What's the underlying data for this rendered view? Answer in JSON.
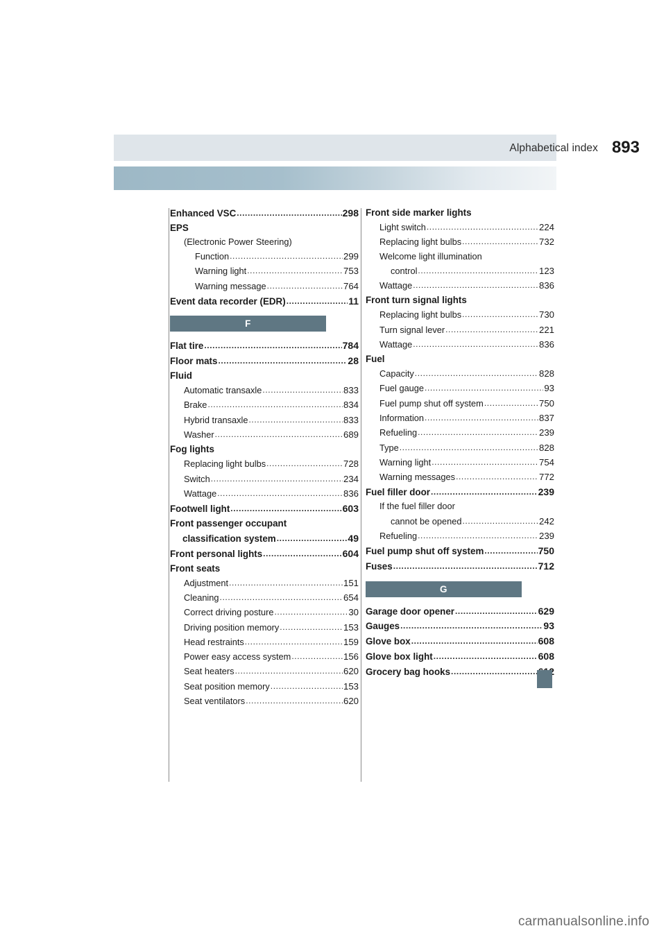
{
  "header": {
    "title": "Alphabetical index",
    "page_number": "893"
  },
  "footer": {
    "watermark": "carmanualsonline.info"
  },
  "left_column": {
    "entries": [
      {
        "level": 0,
        "label": "Enhanced VSC",
        "page": "298"
      },
      {
        "level": 0,
        "label": "EPS",
        "page": ""
      },
      {
        "level": 1,
        "label": "(Electronic Power Steering)",
        "page": "",
        "nodots": true
      },
      {
        "level": 2,
        "label": "Function",
        "page": "299"
      },
      {
        "level": 2,
        "label": "Warning light",
        "page": "753"
      },
      {
        "level": 2,
        "label": "Warning message",
        "page": "764"
      },
      {
        "level": 0,
        "label": "Event data recorder (EDR)",
        "page": "11"
      }
    ],
    "section_letter": "F",
    "entries2": [
      {
        "level": 0,
        "label": "Flat tire",
        "page": "784"
      },
      {
        "level": 0,
        "label": "Floor mats",
        "page": "28"
      },
      {
        "level": 0,
        "label": "Fluid",
        "page": "",
        "nodots": true
      },
      {
        "level": 1,
        "label": "Automatic transaxle",
        "page": "833"
      },
      {
        "level": 1,
        "label": "Brake",
        "page": "834"
      },
      {
        "level": 1,
        "label": "Hybrid transaxle",
        "page": "833"
      },
      {
        "level": 1,
        "label": "Washer",
        "page": "689"
      },
      {
        "level": 0,
        "label": "Fog lights",
        "page": "",
        "nodots": true
      },
      {
        "level": 1,
        "label": "Replacing light bulbs",
        "page": "728"
      },
      {
        "level": 1,
        "label": "Switch",
        "page": "234"
      },
      {
        "level": 1,
        "label": "Wattage",
        "page": "836"
      },
      {
        "level": 0,
        "label": "Footwell light",
        "page": "603"
      },
      {
        "level": 0,
        "label": "Front passenger occupant",
        "page": "",
        "nodots": true
      },
      {
        "level": 0,
        "label": "classification system",
        "page": "49",
        "indent": true
      },
      {
        "level": 0,
        "label": "Front personal lights",
        "page": "604"
      },
      {
        "level": 0,
        "label": "Front seats",
        "page": "",
        "nodots": true
      },
      {
        "level": 1,
        "label": "Adjustment",
        "page": "151"
      },
      {
        "level": 1,
        "label": "Cleaning",
        "page": "654"
      },
      {
        "level": 1,
        "label": "Correct driving posture",
        "page": "30"
      },
      {
        "level": 1,
        "label": "Driving position memory",
        "page": "153"
      },
      {
        "level": 1,
        "label": "Head restraints",
        "page": "159"
      },
      {
        "level": 1,
        "label": "Power easy access system",
        "page": "156"
      },
      {
        "level": 1,
        "label": "Seat heaters",
        "page": "620"
      },
      {
        "level": 1,
        "label": "Seat position memory",
        "page": "153"
      },
      {
        "level": 1,
        "label": "Seat ventilators",
        "page": "620"
      }
    ]
  },
  "right_column": {
    "entries": [
      {
        "level": 0,
        "label": "Front side marker lights",
        "page": "",
        "nodots": true
      },
      {
        "level": 1,
        "label": "Light switch",
        "page": "224"
      },
      {
        "level": 1,
        "label": "Replacing light bulbs",
        "page": "732"
      },
      {
        "level": 1,
        "label": "Welcome light illumination",
        "page": "",
        "nodots": true
      },
      {
        "level": 2,
        "label": "control",
        "page": "123"
      },
      {
        "level": 1,
        "label": "Wattage",
        "page": "836"
      },
      {
        "level": 0,
        "label": "Front turn signal lights",
        "page": "",
        "nodots": true
      },
      {
        "level": 1,
        "label": "Replacing light bulbs",
        "page": "730"
      },
      {
        "level": 1,
        "label": "Turn signal lever",
        "page": "221"
      },
      {
        "level": 1,
        "label": "Wattage",
        "page": "836"
      },
      {
        "level": 0,
        "label": "Fuel",
        "page": "",
        "nodots": true
      },
      {
        "level": 1,
        "label": "Capacity",
        "page": "828"
      },
      {
        "level": 1,
        "label": "Fuel gauge",
        "page": "93"
      },
      {
        "level": 1,
        "label": "Fuel pump shut off system",
        "page": "750"
      },
      {
        "level": 1,
        "label": "Information",
        "page": "837"
      },
      {
        "level": 1,
        "label": "Refueling",
        "page": "239"
      },
      {
        "level": 1,
        "label": "Type",
        "page": "828"
      },
      {
        "level": 1,
        "label": "Warning light",
        "page": "754"
      },
      {
        "level": 1,
        "label": "Warning messages",
        "page": "772"
      },
      {
        "level": 0,
        "label": "Fuel filler door",
        "page": "239"
      },
      {
        "level": 1,
        "label": "If the fuel filler door",
        "page": "",
        "nodots": true
      },
      {
        "level": 2,
        "label": "cannot be opened",
        "page": "242"
      },
      {
        "level": 1,
        "label": "Refueling",
        "page": "239"
      },
      {
        "level": 0,
        "label": "Fuel pump shut off system",
        "page": "750"
      },
      {
        "level": 0,
        "label": "Fuses",
        "page": "712"
      }
    ],
    "section_letter": "G",
    "entries2": [
      {
        "level": 0,
        "label": "Garage door opener",
        "page": "629"
      },
      {
        "level": 0,
        "label": "Gauges",
        "page": "93"
      },
      {
        "level": 0,
        "label": "Glove box",
        "page": "608"
      },
      {
        "level": 0,
        "label": "Glove box light",
        "page": "608"
      },
      {
        "level": 0,
        "label": "Grocery bag hooks",
        "page": "612"
      }
    ]
  }
}
